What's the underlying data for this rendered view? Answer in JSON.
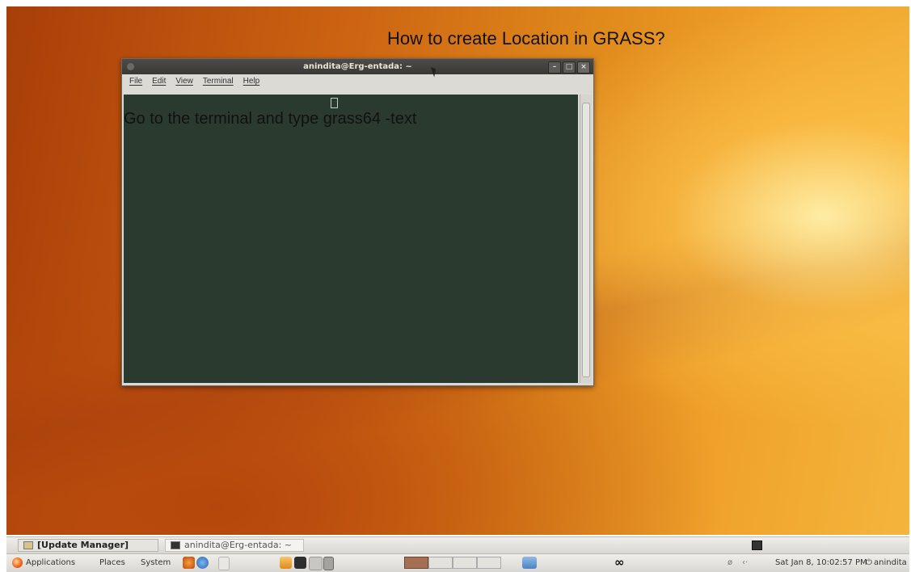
{
  "overlay": {
    "title": "How to create Location in GRASS?",
    "step": "Go to the terminal and type grass64 -text"
  },
  "terminal": {
    "window_title": "anindita@Erg-entada: ~",
    "menu": [
      "File",
      "Edit",
      "View",
      "Terminal",
      "Help"
    ],
    "minimize_glyph": "–",
    "maximize_glyph": "□",
    "close_glyph": "×"
  },
  "taskbar": {
    "items": [
      "[Update Manager]",
      "anindita@Erg-entada: ~"
    ]
  },
  "top_panel": {
    "menus": [
      "Applications",
      "Places",
      "System"
    ],
    "infinity_glyph": "∞",
    "network_glyph": "ø",
    "volume_glyph": "‹·",
    "clock": "Sat Jan  8, 10:02:57 PM",
    "user": "anindita",
    "power_glyph": "⏻"
  },
  "colors": {
    "terminal_background": "#2b3a2e",
    "desktop_accent": "#e08a1c"
  }
}
